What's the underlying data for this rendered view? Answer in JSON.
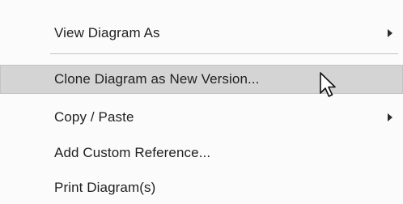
{
  "menu": {
    "items": [
      {
        "label": "View Diagram As",
        "submenu_icon": "chevron-right-icon"
      },
      {
        "label": "Clone Diagram as New Version...",
        "highlighted": true
      },
      {
        "label": "Copy / Paste",
        "submenu_icon": "chevron-right-icon"
      },
      {
        "label": "Add Custom Reference..."
      },
      {
        "label": "Print Diagram(s)"
      }
    ]
  },
  "cursor": {
    "icon": "mouse-pointer-icon"
  },
  "colors": {
    "menu_background": "#fbfbfb",
    "highlight_background": "#d4d4d4",
    "text": "#1f1f1f"
  }
}
